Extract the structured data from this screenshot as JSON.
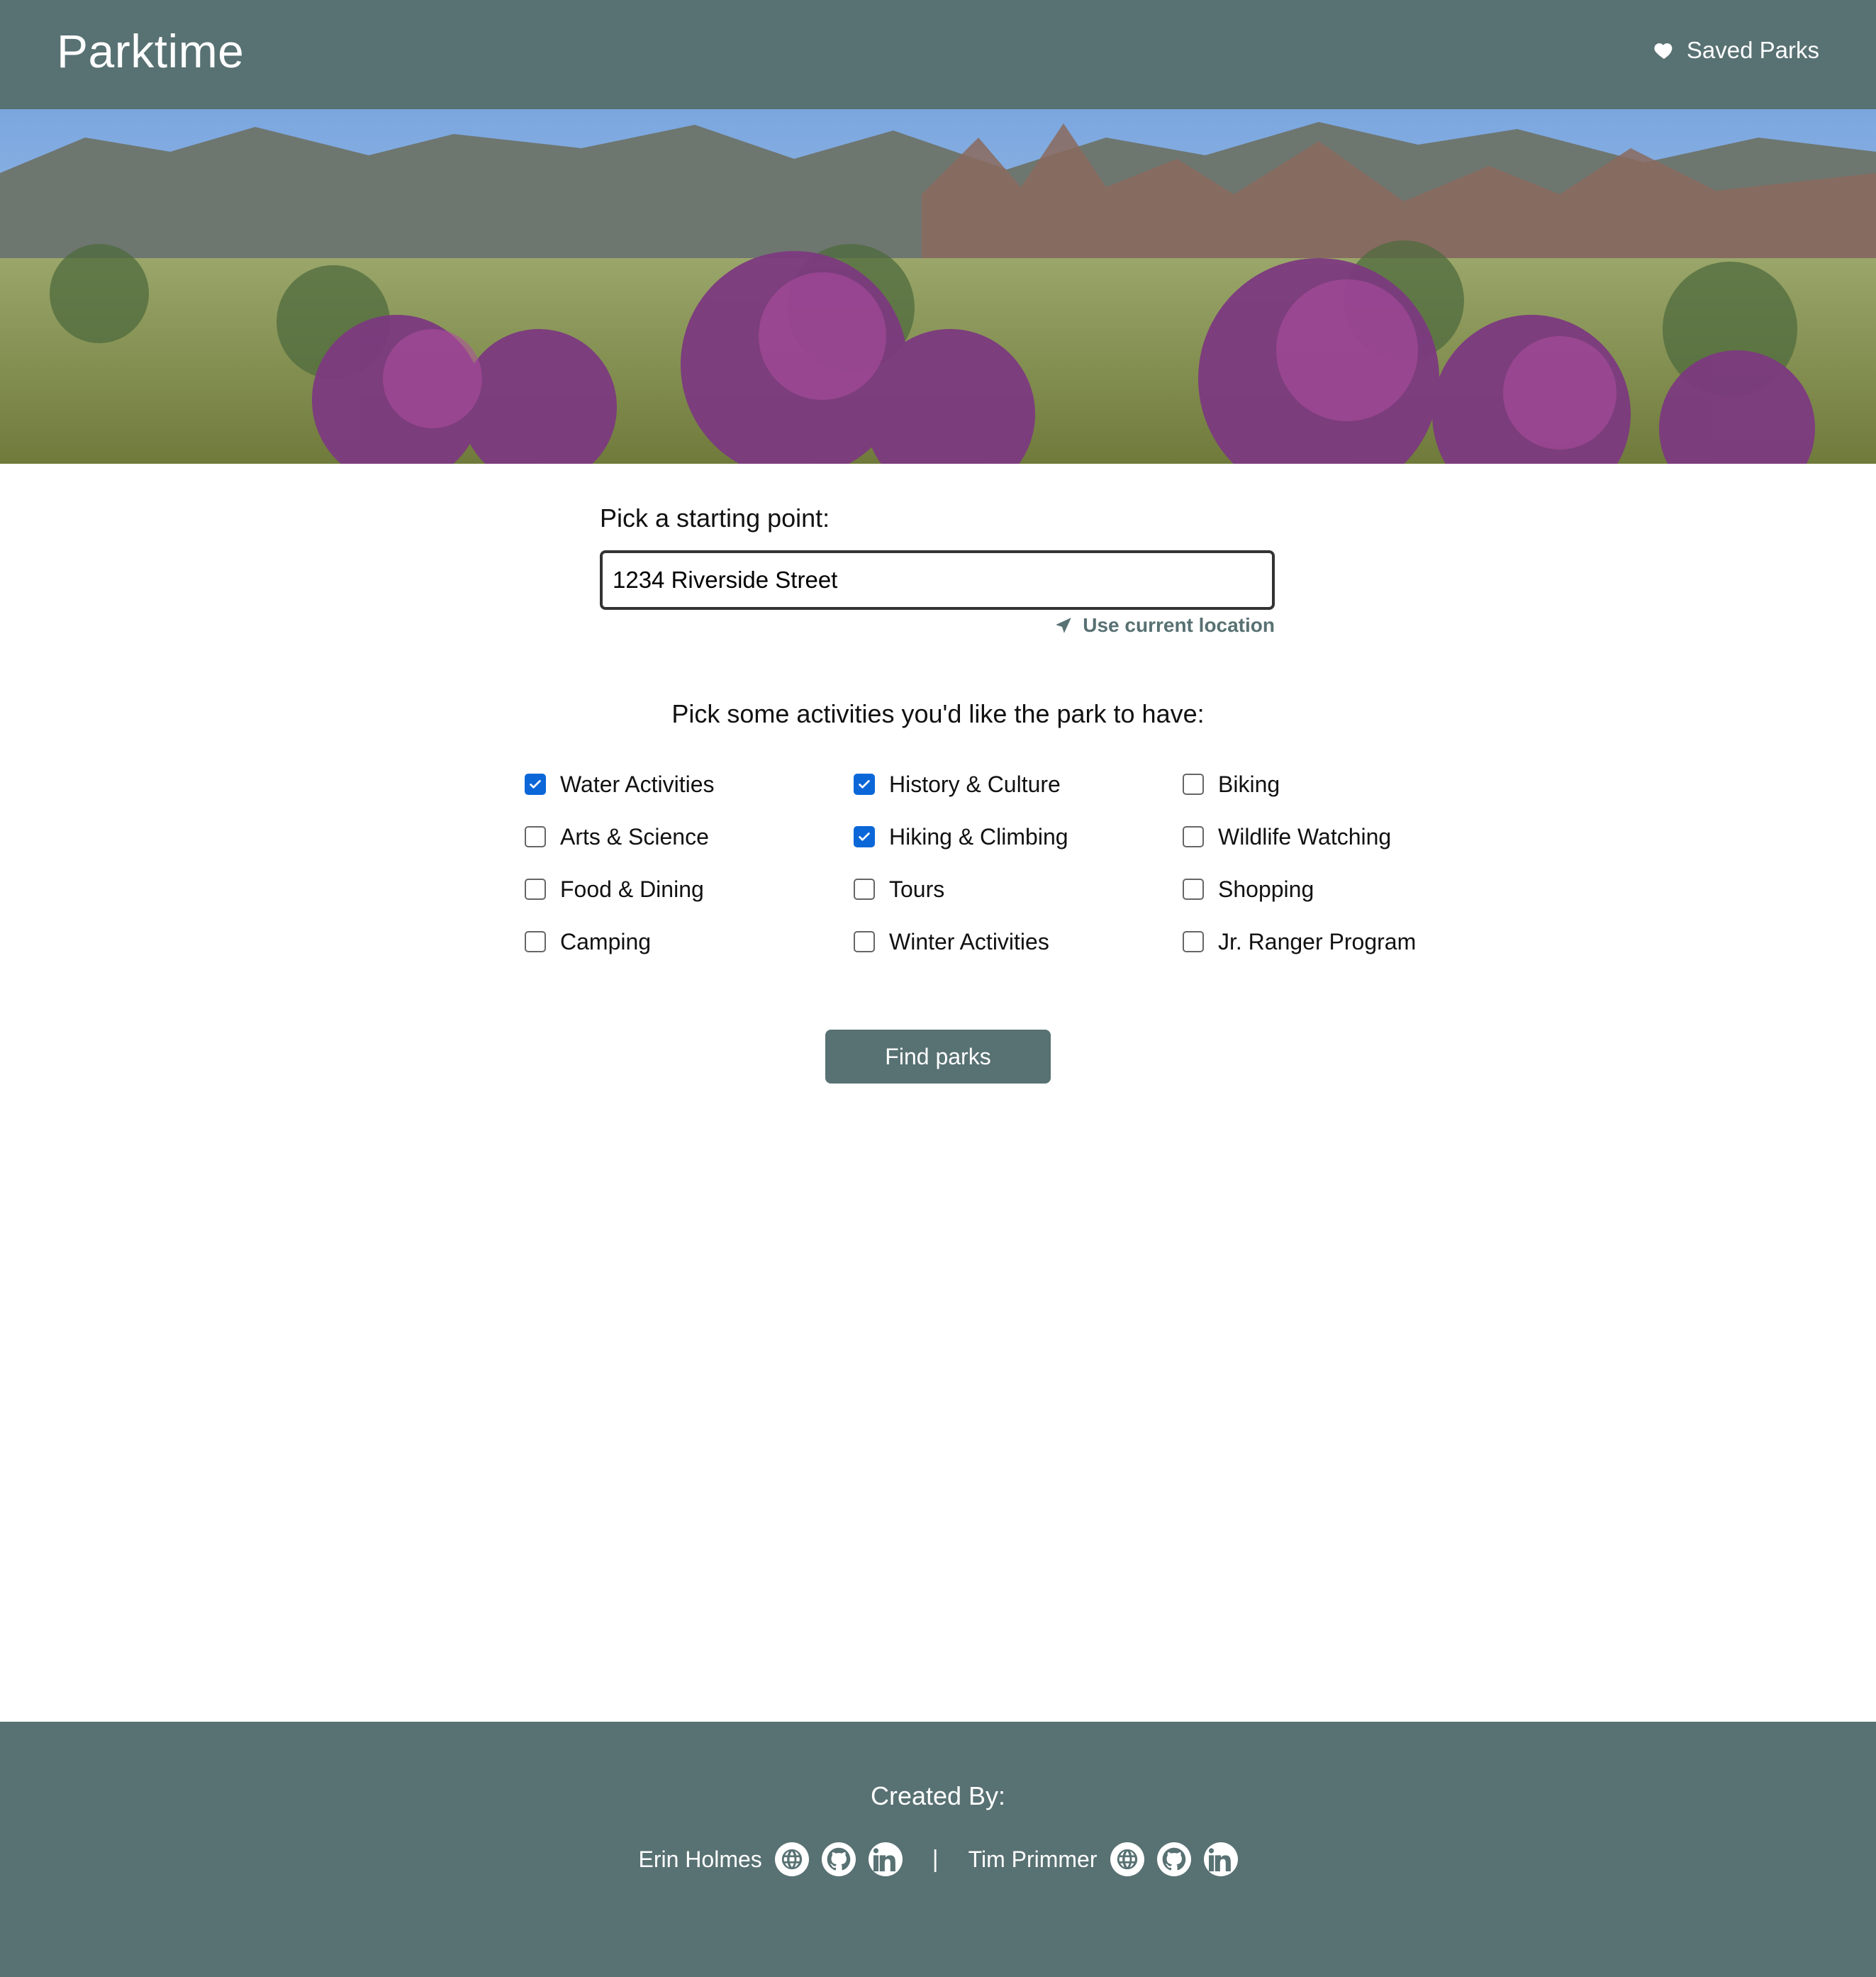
{
  "app": {
    "title": "Parktime",
    "saved_link": "Saved Parks"
  },
  "colors": {
    "brand": "#587173",
    "checkbox_checked": "#0b67d8"
  },
  "search": {
    "label": "Pick a starting point:",
    "value": "1234 Riverside Street",
    "use_current_location": "Use current location"
  },
  "activities": {
    "title": "Pick some activities you'd like the park to have:",
    "options": [
      {
        "label": "Water Activities",
        "checked": true
      },
      {
        "label": "History & Culture",
        "checked": true
      },
      {
        "label": "Biking",
        "checked": false
      },
      {
        "label": "Arts & Science",
        "checked": false
      },
      {
        "label": "Hiking & Climbing",
        "checked": true
      },
      {
        "label": "Wildlife Watching",
        "checked": false
      },
      {
        "label": "Food & Dining",
        "checked": false
      },
      {
        "label": "Tours",
        "checked": false
      },
      {
        "label": "Shopping",
        "checked": false
      },
      {
        "label": "Camping",
        "checked": false
      },
      {
        "label": "Winter Activities",
        "checked": false
      },
      {
        "label": "Jr. Ranger Program",
        "checked": false
      }
    ]
  },
  "actions": {
    "find_label": "Find parks"
  },
  "footer": {
    "created_by": "Created By:",
    "separator": "|",
    "creators": [
      {
        "name": "Erin Holmes",
        "icons": [
          "globe-icon",
          "github-icon",
          "linkedin-icon"
        ]
      },
      {
        "name": "Tim Primmer",
        "icons": [
          "globe-icon",
          "github-icon",
          "linkedin-icon"
        ]
      }
    ]
  }
}
